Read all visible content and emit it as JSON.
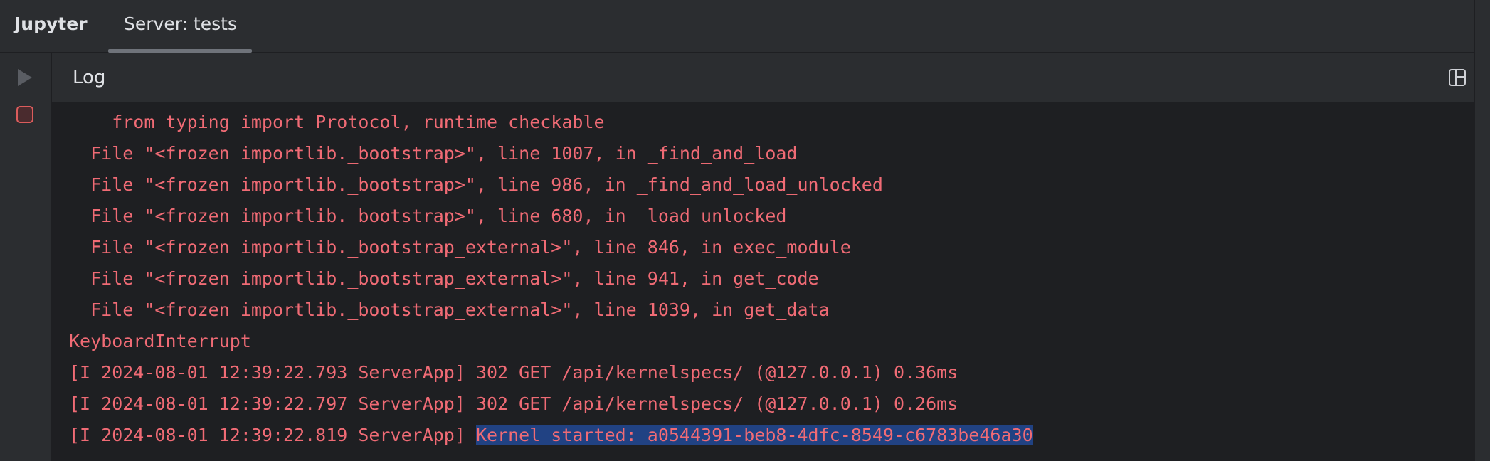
{
  "header": {
    "app_title": "Jupyter",
    "tabs": [
      {
        "label": "Server: tests",
        "active": true
      }
    ]
  },
  "toolbar": {
    "icons": [
      "run-icon",
      "stop-icon"
    ]
  },
  "panel": {
    "title": "Log",
    "layout_icon": "layout-icon"
  },
  "log": {
    "lines": [
      "    from typing import Protocol, runtime_checkable",
      "  File \"<frozen importlib._bootstrap>\", line 1007, in _find_and_load",
      "  File \"<frozen importlib._bootstrap>\", line 986, in _find_and_load_unlocked",
      "  File \"<frozen importlib._bootstrap>\", line 680, in _load_unlocked",
      "  File \"<frozen importlib._bootstrap_external>\", line 846, in exec_module",
      "  File \"<frozen importlib._bootstrap_external>\", line 941, in get_code",
      "  File \"<frozen importlib._bootstrap_external>\", line 1039, in get_data",
      "KeyboardInterrupt",
      "[I 2024-08-01 12:39:22.793 ServerApp] 302 GET /api/kernelspecs/ (@127.0.0.1) 0.36ms",
      "[I 2024-08-01 12:39:22.797 ServerApp] 302 GET /api/kernelspecs/ (@127.0.0.1) 0.26ms"
    ],
    "last_line_prefix": "[I 2024-08-01 12:39:22.819 ServerApp] ",
    "last_line_selected": "Kernel started: a0544391-beb8-4dfc-8549-c6783be46a30"
  },
  "colors": {
    "error_text": "#f06b75",
    "selection": "#214283",
    "background": "#1e1f22",
    "chrome": "#2b2d30",
    "run_icon": "#5a5d63",
    "stop_icon": "#db5c5c"
  }
}
